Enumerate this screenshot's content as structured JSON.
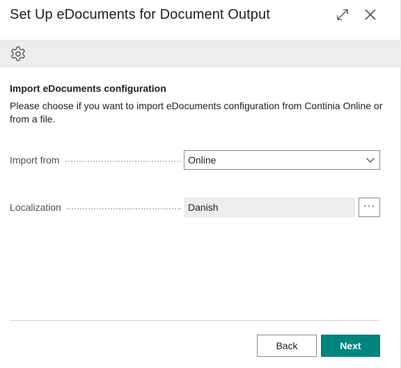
{
  "dialog": {
    "title": "Set Up eDocuments for Document Output"
  },
  "icons": {
    "expand": "expand-diagonal-icon",
    "close": "close-icon",
    "settings": "gear-icon",
    "dropdown": "chevron-down-icon"
  },
  "section": {
    "title": "Import eDocuments configuration",
    "description": "Please choose if you want to import eDocuments configuration from Continia Online or from a file."
  },
  "fields": {
    "import_from": {
      "label": "Import from",
      "value": "Online"
    },
    "localization": {
      "label": "Localization",
      "value": "Danish",
      "lookup_label": "···"
    }
  },
  "footer": {
    "back_label": "Back",
    "next_label": "Next"
  },
  "colors": {
    "accent": "#00857e",
    "toolbar_bg": "#ededed",
    "readonly_bg": "#ededed"
  }
}
